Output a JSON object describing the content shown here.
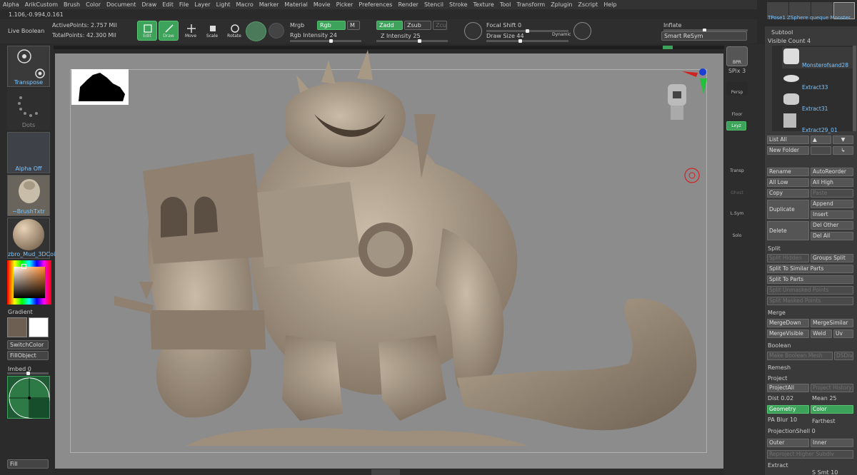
{
  "menu": [
    "Alpha",
    "ArikCustom",
    "Brush",
    "Color",
    "Document",
    "Draw",
    "Edit",
    "File",
    "Layer",
    "Light",
    "Macro",
    "Marker",
    "Material",
    "Movie",
    "Picker",
    "Preferences",
    "Render",
    "Stencil",
    "Stroke",
    "Texture",
    "Tool",
    "Transform",
    "Zplugin",
    "Zscript",
    "Help"
  ],
  "coords": "1.106,-0.994,0.161",
  "topbar": {
    "live_boolean": "Live Boolean",
    "active_points": "ActivePoints: 2.757 Mil",
    "total_points": "TotalPoints: 42.300 Mil",
    "edit": "Edit",
    "draw": "Draw",
    "move": "Move",
    "scale": "Scale",
    "rotate": "Rotate",
    "mrgb": "Mrgb",
    "rgb": "Rgb",
    "m": "M",
    "rgb_intensity_label": "Rgb Intensity",
    "rgb_intensity": "24",
    "zadd": "Zadd",
    "zsub": "Zsub",
    "zcut": "Zcut",
    "z_intensity_label": "Z Intensity",
    "z_intensity": "25",
    "focal_shift_label": "Focal Shift",
    "focal_shift": "0",
    "draw_size_label": "Draw Size",
    "draw_size": "44",
    "dynamic": "Dynamic",
    "inflate": "Inflate",
    "smart_resym": "Smart ReSym"
  },
  "left": {
    "transpose": "Transpose",
    "dots": "Dots",
    "alpha_off": "Alpha Off",
    "brush": "~BrushTxtr",
    "material": "zbro_Mud_3DCoi",
    "gradient": "Gradient",
    "switch_color": "SwitchColor",
    "fill_object": "FillObject",
    "imbed_label": "Imbed",
    "imbed": "0",
    "fill": "Fill"
  },
  "right_tray": {
    "bpr": "BPR",
    "spix_label": "SPix",
    "spix": "3",
    "persp": "Persp",
    "floor": "Floor",
    "xyz": "Lxyz",
    "transp": "Transp",
    "ghost": "Ghost",
    "lsym": "L.Sym",
    "solo": "Solo"
  },
  "panel": {
    "top_thumbs": [
      "TPose1",
      "ZSphere",
      "queque",
      "Monster"
    ],
    "subtool": "Subtool",
    "visible_count": "Visible Count 4",
    "subtools": [
      "Monsterofsand28",
      "Extract33",
      "Extract31",
      "Extract29_01"
    ],
    "list_all": "List All",
    "new_folder": "New Folder",
    "rename": "Rename",
    "auto_reorder": "AutoReorder",
    "all_low": "All Low",
    "all_high": "All High",
    "copy": "Copy",
    "paste": "Paste",
    "duplicate": "Duplicate",
    "append": "Append",
    "insert": "Insert",
    "delete": "Delete",
    "del_other": "Del Other",
    "del_all": "Del All",
    "split": "Split",
    "split_hidden": "Split Hidden",
    "groups_split": "Groups Split",
    "split_similar": "Split To Similar Parts",
    "split_parts": "Split To Parts",
    "split_unmasked": "Split Unmasked Points",
    "split_masked": "Split Masked Points",
    "merge": "Merge",
    "merge_down": "MergeDown",
    "merge_similar": "MergeSimilar",
    "merge_visible": "MergeVisible",
    "weld": "Weld",
    "uv": "Uv",
    "boolean": "Boolean",
    "make_boolean": "Make Boolean Mesh",
    "dsdiv": "DSDiv",
    "remesh": "Remesh",
    "project": "Project",
    "project_all": "ProjectAll",
    "project_history": "Project History",
    "dist_label": "Dist",
    "dist": "0.02",
    "mean_label": "Mean",
    "mean": "25",
    "geometry": "Geometry",
    "color": "Color",
    "pa_blur_label": "PA Blur",
    "pa_blur": "10",
    "farthest": "Farthest",
    "projection_shell_label": "ProjectionShell",
    "projection_shell": "0",
    "outer": "Outer",
    "inner": "Inner",
    "reproject": "Reproject Higher Subdiv",
    "extract": "Extract",
    "s_smt": "S Smt 10"
  },
  "colors": {
    "accent_green": "#3da35a",
    "link_blue": "#7ec6ff"
  }
}
